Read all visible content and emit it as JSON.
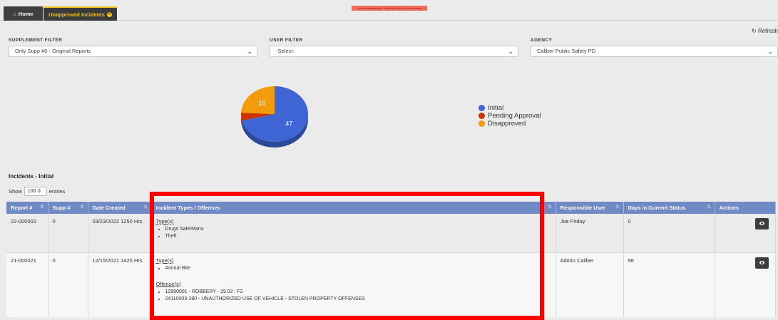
{
  "tabs": {
    "home_label": "Home",
    "unapproved_label": "Unapproved Incidents"
  },
  "env_banner": "You are accessing a Training or Demo Environment",
  "refresh_label": "Refresh",
  "filters": {
    "supplement": {
      "label": "Supplement Filter",
      "value": "Only Supp #0 - Original Reports"
    },
    "user": {
      "label": "User Filter",
      "value": "-Select-"
    },
    "agency": {
      "label": "Agency",
      "value": "Caliber Public Safety PD"
    }
  },
  "chart_data": {
    "type": "pie",
    "categories": [
      "Initial",
      "Pending Approval",
      "Disapproved"
    ],
    "values": [
      47,
      3,
      16
    ],
    "colors": [
      "#3f64d4",
      "#cc3300",
      "#f29b0c"
    ],
    "slice_labels": [
      "47",
      "",
      "16"
    ],
    "legend_position": "right"
  },
  "section_title": "Incidents - Initial",
  "show_entries": {
    "prefix": "Show",
    "value": "100",
    "suffix": "entries"
  },
  "table": {
    "headers": [
      "Report #",
      "Supp #",
      "Date Created",
      "Incident Types / Offenses",
      "Responsible User",
      "Days in Current Status",
      "Actions"
    ],
    "rows": [
      {
        "report": "22-000003",
        "supp": "0",
        "date": "03/23/2022 1250 Hrs",
        "types_label": "Type(s)",
        "types": [
          "Drugs Sale/Manu",
          "Theft"
        ],
        "user": "Joe Friday",
        "days": "0"
      },
      {
        "report": "21-000021",
        "supp": "0",
        "date": "12/15/2021 1425 Hrs",
        "types_label": "Type(s)",
        "types": [
          "Animal Bite"
        ],
        "offenses_label": "Offense(s)",
        "offenses": [
          "12990001 - ROBBERY - 29.02 : F2",
          "24110003-280 - UNAUTHORIZED USE OF VEHICLE - STOLEN PROPERTY OFFENSES"
        ],
        "user": "Admin Caliber",
        "days": "98"
      }
    ]
  }
}
